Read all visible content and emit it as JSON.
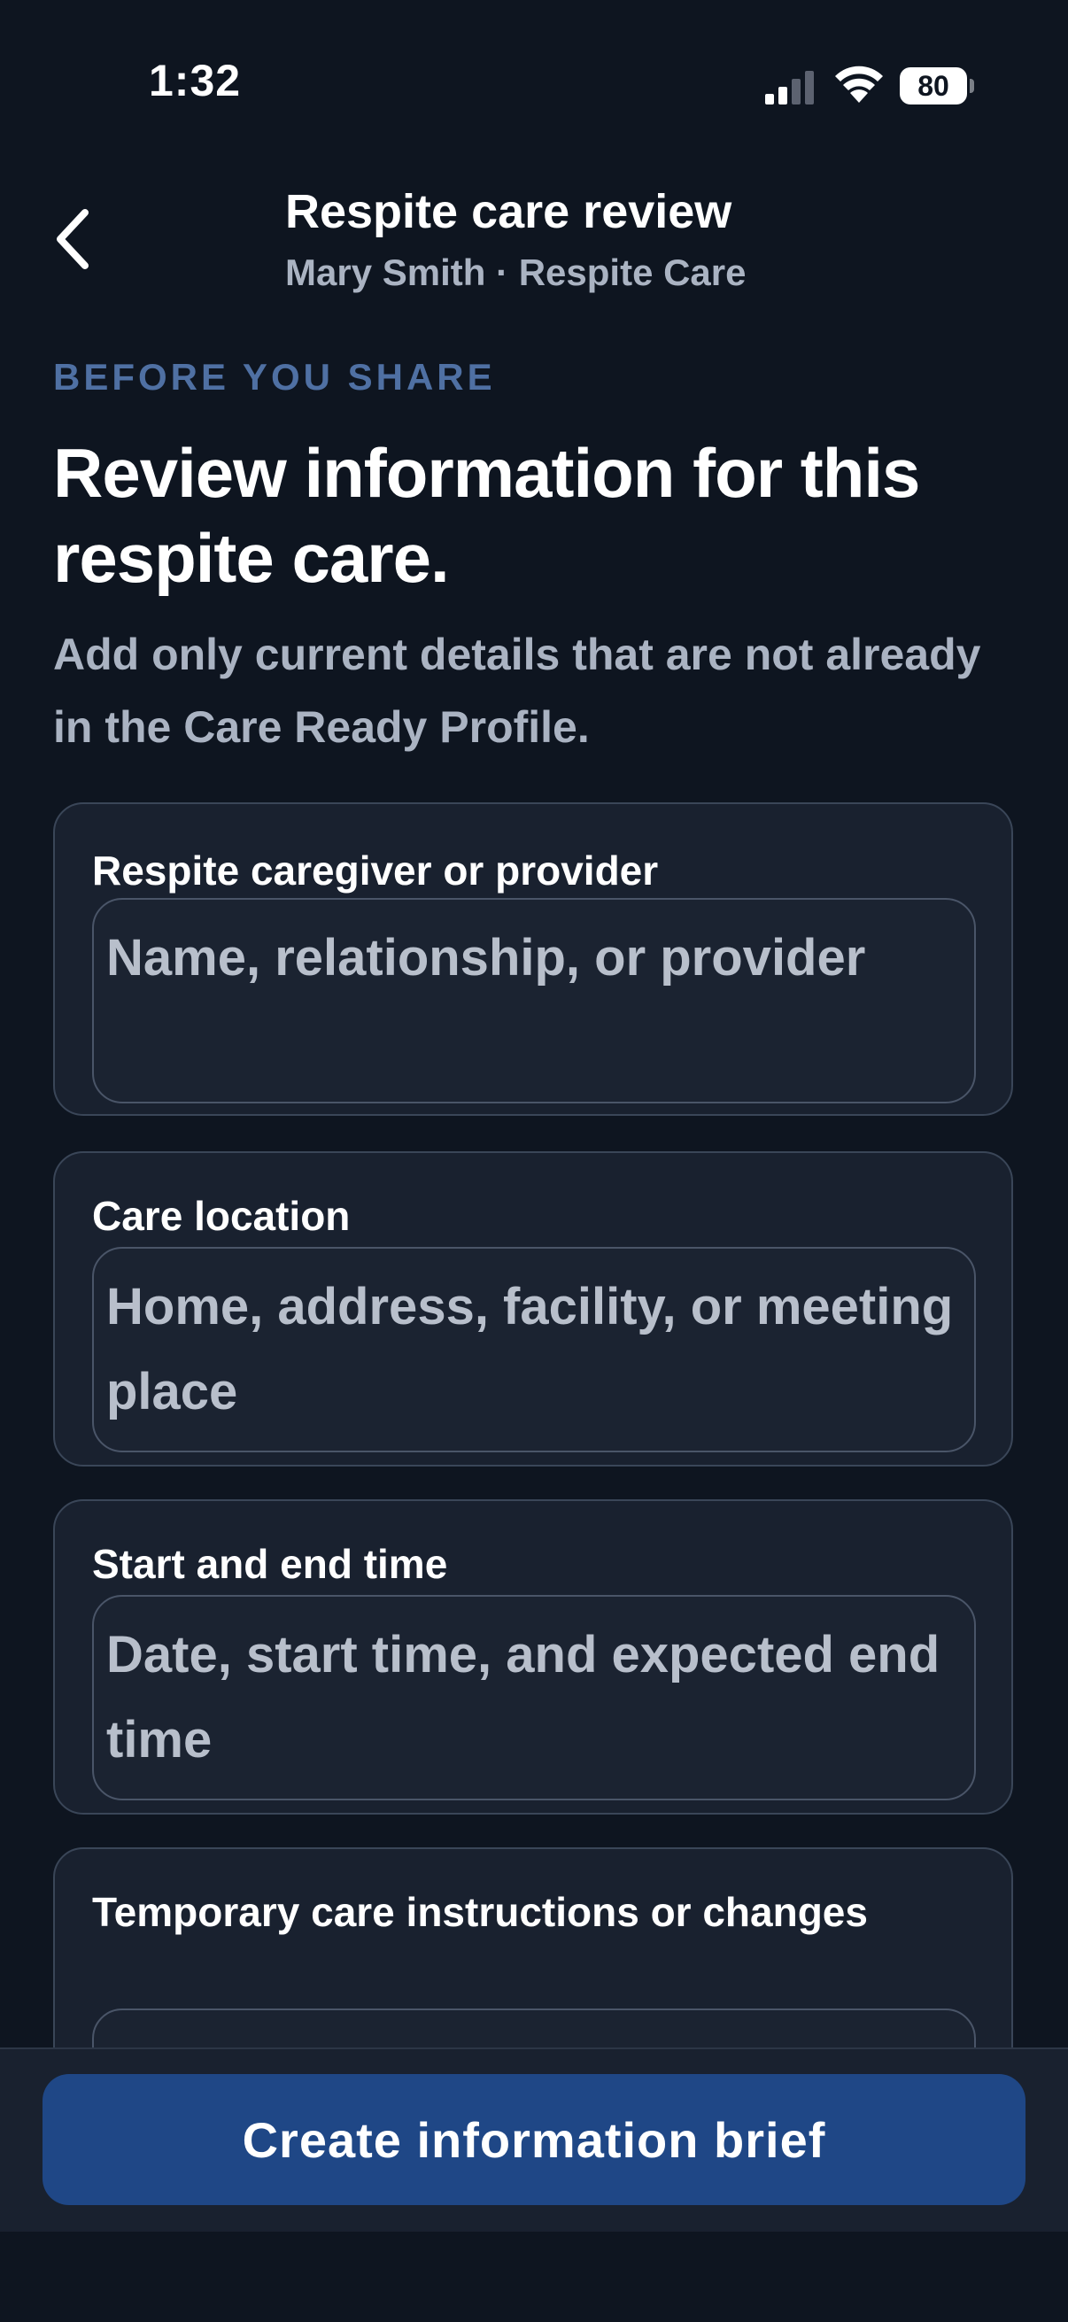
{
  "status_bar": {
    "time": "1:32",
    "battery": "80",
    "icons": [
      "signal-icon",
      "wifi-icon",
      "battery-icon"
    ]
  },
  "header": {
    "back_icon": "chevron-left-icon",
    "title": "Respite care review",
    "subtitle": "Mary Smith · Respite Care"
  },
  "intro": {
    "eyebrow": "BEFORE YOU SHARE",
    "headline": "Review information for this respite care.",
    "description": "Add only current details that are not already in the Care Ready Profile."
  },
  "fields": [
    {
      "label": "Respite caregiver or provider",
      "placeholder": "Name, relationship, or provider",
      "value": ""
    },
    {
      "label": "Care location",
      "placeholder": "Home, address, facility, or meeting place",
      "value": ""
    },
    {
      "label": "Start and end time",
      "placeholder": "Date, start time, and expected end time",
      "value": ""
    },
    {
      "label": "Temporary care instructions or changes",
      "placeholder": "",
      "value": ""
    }
  ],
  "footer": {
    "primary_button_label": "Create information brief"
  },
  "colors": {
    "background": "#0e1520",
    "card": "#19212f",
    "accent": "#1f4786",
    "eyebrow": "#4f70a3",
    "muted_text": "#aab3c2"
  }
}
